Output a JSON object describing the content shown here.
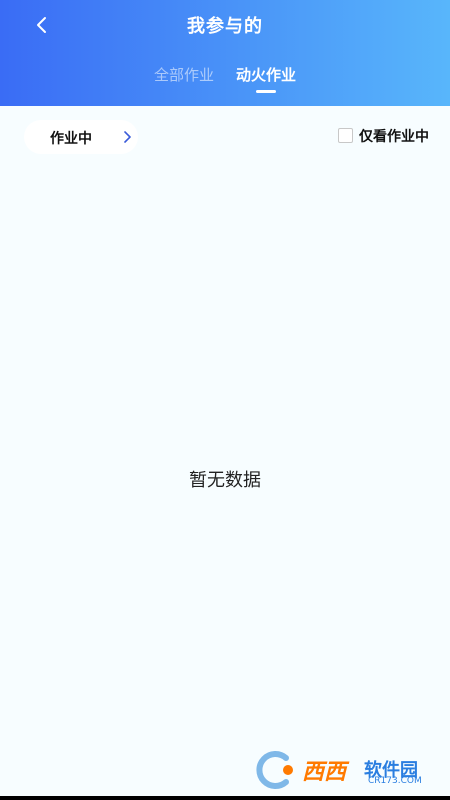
{
  "header": {
    "title": "我参与的",
    "back_icon": "chevron-left-icon"
  },
  "tabs": [
    {
      "label": "全部作业",
      "active": false
    },
    {
      "label": "动火作业",
      "active": true
    }
  ],
  "filter": {
    "status_label": "作业中",
    "status_icon": "chevron-right-icon",
    "only_active_label": "仅看作业中",
    "only_active_checked": false
  },
  "content": {
    "empty_text": "暂无数据"
  },
  "watermark": {
    "text_main": "西西",
    "text_site": "软件园",
    "url": "CR173.COM"
  },
  "colors": {
    "header_start": "#3a6cf5",
    "header_end": "#58b6fb",
    "accent": "#3a5bd9",
    "background": "#f7fdff"
  }
}
